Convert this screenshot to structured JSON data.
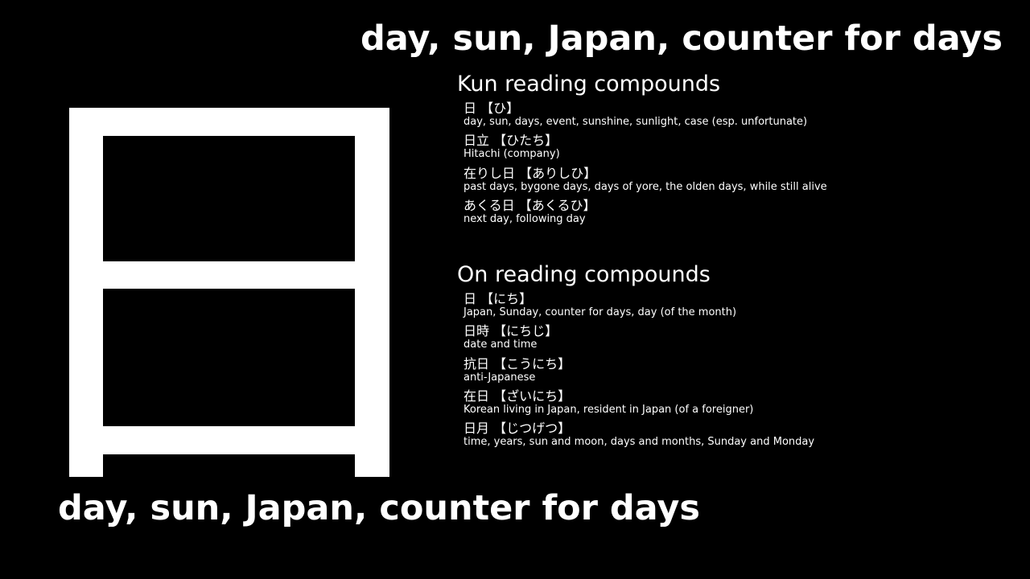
{
  "top_title": "day, sun, Japan, counter for days",
  "bottom_title": "day, sun, Japan, counter for days",
  "kanji": {
    "character": "日",
    "color": "#ffffff",
    "background": "#000000"
  },
  "kun_section": {
    "heading": "Kun reading compounds",
    "entries": [
      {
        "term": "日 【ひ】",
        "meaning": "day, sun, days, event, sunshine, sunlight, case (esp. unfortunate)"
      },
      {
        "term": "日立 【ひたち】",
        "meaning": "Hitachi (company)"
      },
      {
        "term": "在りし日 【ありしひ】",
        "meaning": "past days, bygone days, days of yore, the olden days, while still alive"
      },
      {
        "term": "あくる日 【あくるひ】",
        "meaning": "next day, following day"
      }
    ]
  },
  "on_section": {
    "heading": "On reading compounds",
    "entries": [
      {
        "term": "日 【にち】",
        "meaning": "Japan, Sunday, counter for days, day (of the month)"
      },
      {
        "term": "日時 【にちじ】",
        "meaning": "date and time"
      },
      {
        "term": "抗日 【こうにち】",
        "meaning": "anti-Japanese"
      },
      {
        "term": "在日 【ざいにち】",
        "meaning": "Korean living in Japan, resident in Japan (of a foreigner)"
      },
      {
        "term": "日月 【じつげつ】",
        "meaning": "time, years, sun and moon, days and months, Sunday and Monday"
      }
    ]
  }
}
